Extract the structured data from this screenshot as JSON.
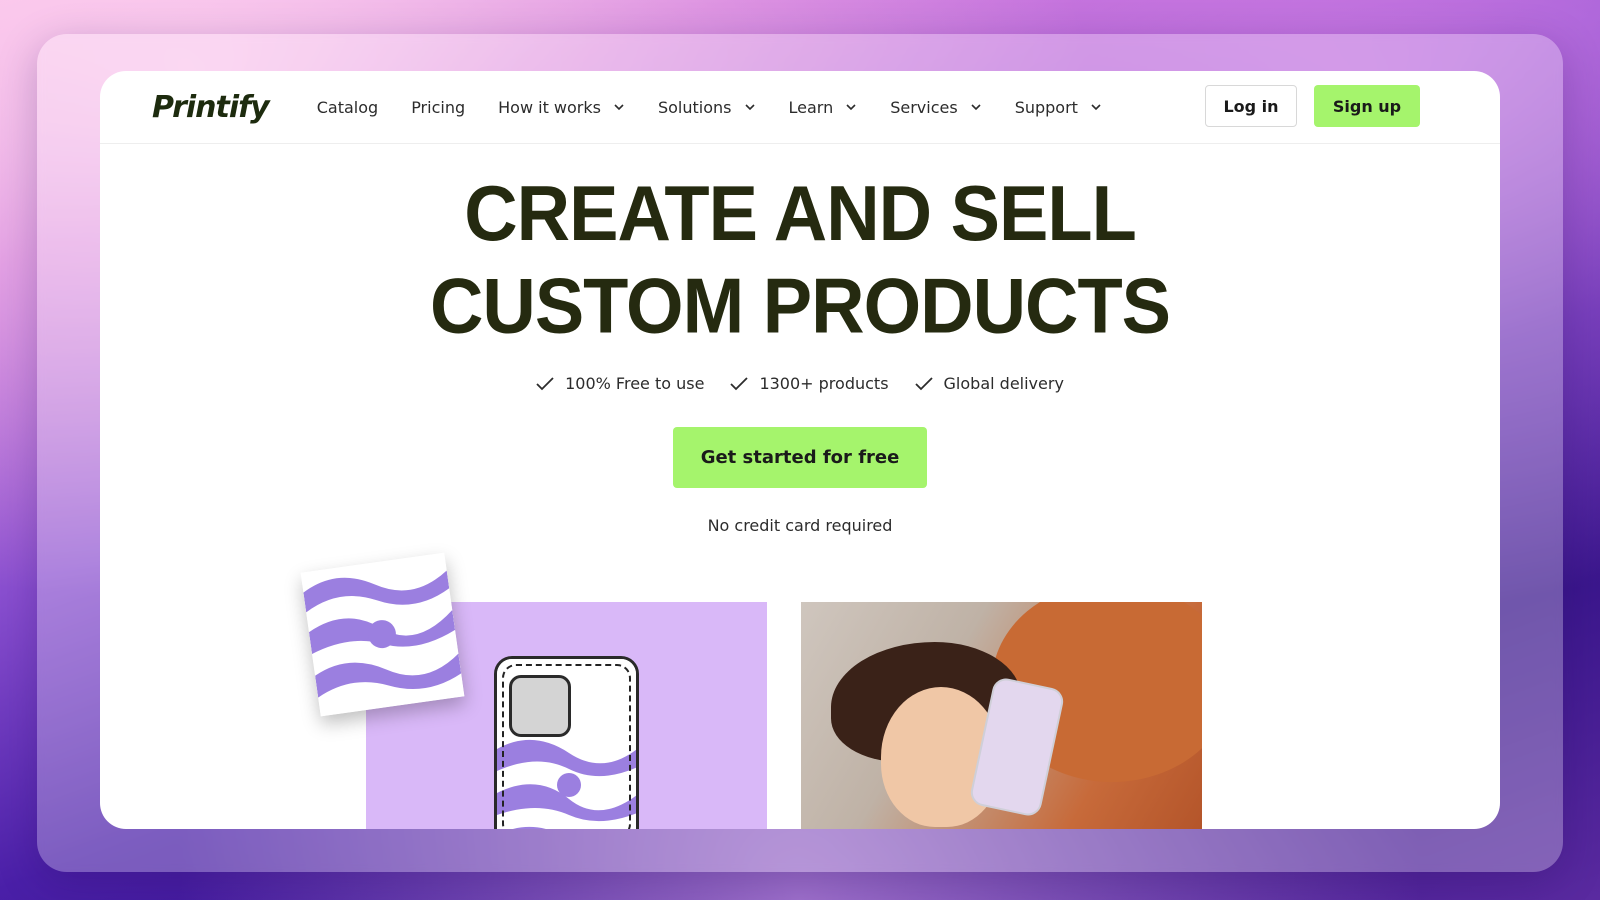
{
  "brand": {
    "logo": "Printify"
  },
  "nav": {
    "items": [
      {
        "label": "Catalog",
        "dropdown": false
      },
      {
        "label": "Pricing",
        "dropdown": false
      },
      {
        "label": "How it works",
        "dropdown": true
      },
      {
        "label": "Solutions",
        "dropdown": true
      },
      {
        "label": "Learn",
        "dropdown": true
      },
      {
        "label": "Services",
        "dropdown": true
      },
      {
        "label": "Support",
        "dropdown": true
      }
    ],
    "login_label": "Log in",
    "signup_label": "Sign up"
  },
  "hero": {
    "headline_line1": "CREATE AND SELL",
    "headline_line2": "CUSTOM PRODUCTS",
    "features": [
      "100% Free to use",
      "1300+ products",
      "Global delivery"
    ],
    "cta_label": "Get started for free",
    "note": "No credit card required"
  },
  "colors": {
    "accent": "#a5f46c",
    "headline": "#252a10",
    "product_bg": "#d9b8f8",
    "pattern_purple": "#9b7fe0"
  },
  "icons": {
    "feature": "check-icon",
    "dropdown": "chevron-down-icon"
  }
}
